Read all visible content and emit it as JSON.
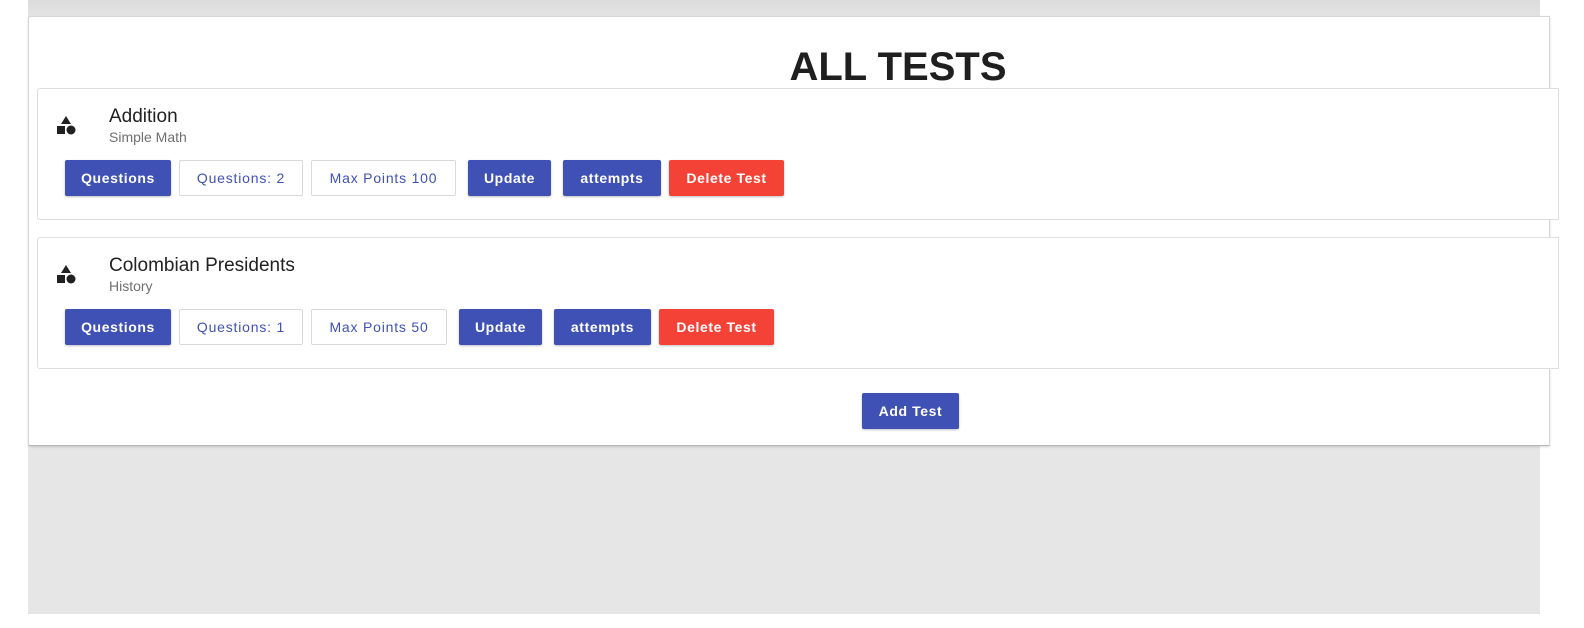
{
  "page": {
    "title": "ALL TESTS",
    "add_test_label": "Add Test"
  },
  "tests": [
    {
      "title": "Addition",
      "subtitle": "Simple Math",
      "questions_label": "Questions",
      "questions_count": "Questions: 2",
      "max_points": "Max Points 100",
      "update_label": "Update",
      "attempts_label": "attempts",
      "delete_label": "Delete Test",
      "icon": "shapes-icon"
    },
    {
      "title": "Colombian Presidents",
      "subtitle": "History",
      "questions_label": "Questions",
      "questions_count": "Questions: 1",
      "max_points": "Max Points 50",
      "update_label": "Update",
      "attempts_label": "attempts",
      "delete_label": "Delete Test",
      "icon": "shapes-icon"
    }
  ],
  "colors": {
    "primary": "#3f51b5",
    "danger": "#f44336",
    "background": "#e6e6e6"
  }
}
